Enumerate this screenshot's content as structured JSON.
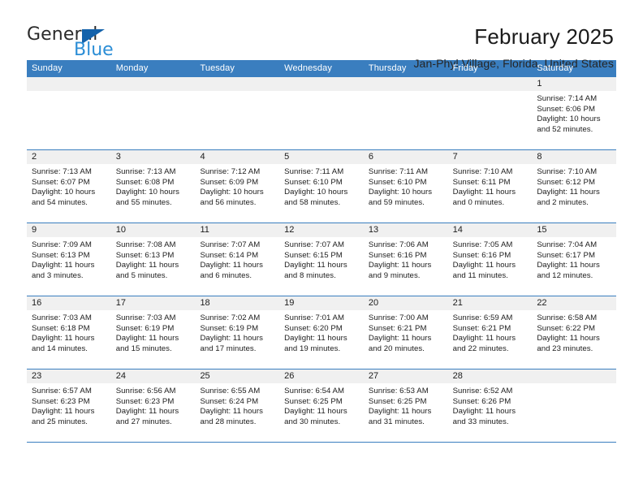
{
  "brand": {
    "name_part1": "General",
    "name_part2": "Blue",
    "triangle_color": "#1462ab",
    "blue_color": "#2c8ed6"
  },
  "header": {
    "title": "February 2025",
    "subtitle": "Jan-Phyl Village, Florida, United States",
    "accent_color": "#3a7ebf"
  },
  "weekdays": [
    "Sunday",
    "Monday",
    "Tuesday",
    "Wednesday",
    "Thursday",
    "Friday",
    "Saturday"
  ],
  "weeks": [
    [
      {
        "day": "",
        "empty": true
      },
      {
        "day": "",
        "empty": true
      },
      {
        "day": "",
        "empty": true
      },
      {
        "day": "",
        "empty": true
      },
      {
        "day": "",
        "empty": true
      },
      {
        "day": "",
        "empty": true
      },
      {
        "day": "1",
        "sunrise": "Sunrise: 7:14 AM",
        "sunset": "Sunset: 6:06 PM",
        "daylight_line1": "Daylight: 10 hours",
        "daylight_line2": "and 52 minutes."
      }
    ],
    [
      {
        "day": "2",
        "sunrise": "Sunrise: 7:13 AM",
        "sunset": "Sunset: 6:07 PM",
        "daylight_line1": "Daylight: 10 hours",
        "daylight_line2": "and 54 minutes."
      },
      {
        "day": "3",
        "sunrise": "Sunrise: 7:13 AM",
        "sunset": "Sunset: 6:08 PM",
        "daylight_line1": "Daylight: 10 hours",
        "daylight_line2": "and 55 minutes."
      },
      {
        "day": "4",
        "sunrise": "Sunrise: 7:12 AM",
        "sunset": "Sunset: 6:09 PM",
        "daylight_line1": "Daylight: 10 hours",
        "daylight_line2": "and 56 minutes."
      },
      {
        "day": "5",
        "sunrise": "Sunrise: 7:11 AM",
        "sunset": "Sunset: 6:10 PM",
        "daylight_line1": "Daylight: 10 hours",
        "daylight_line2": "and 58 minutes."
      },
      {
        "day": "6",
        "sunrise": "Sunrise: 7:11 AM",
        "sunset": "Sunset: 6:10 PM",
        "daylight_line1": "Daylight: 10 hours",
        "daylight_line2": "and 59 minutes."
      },
      {
        "day": "7",
        "sunrise": "Sunrise: 7:10 AM",
        "sunset": "Sunset: 6:11 PM",
        "daylight_line1": "Daylight: 11 hours",
        "daylight_line2": "and 0 minutes."
      },
      {
        "day": "8",
        "sunrise": "Sunrise: 7:10 AM",
        "sunset": "Sunset: 6:12 PM",
        "daylight_line1": "Daylight: 11 hours",
        "daylight_line2": "and 2 minutes."
      }
    ],
    [
      {
        "day": "9",
        "sunrise": "Sunrise: 7:09 AM",
        "sunset": "Sunset: 6:13 PM",
        "daylight_line1": "Daylight: 11 hours",
        "daylight_line2": "and 3 minutes."
      },
      {
        "day": "10",
        "sunrise": "Sunrise: 7:08 AM",
        "sunset": "Sunset: 6:13 PM",
        "daylight_line1": "Daylight: 11 hours",
        "daylight_line2": "and 5 minutes."
      },
      {
        "day": "11",
        "sunrise": "Sunrise: 7:07 AM",
        "sunset": "Sunset: 6:14 PM",
        "daylight_line1": "Daylight: 11 hours",
        "daylight_line2": "and 6 minutes."
      },
      {
        "day": "12",
        "sunrise": "Sunrise: 7:07 AM",
        "sunset": "Sunset: 6:15 PM",
        "daylight_line1": "Daylight: 11 hours",
        "daylight_line2": "and 8 minutes."
      },
      {
        "day": "13",
        "sunrise": "Sunrise: 7:06 AM",
        "sunset": "Sunset: 6:16 PM",
        "daylight_line1": "Daylight: 11 hours",
        "daylight_line2": "and 9 minutes."
      },
      {
        "day": "14",
        "sunrise": "Sunrise: 7:05 AM",
        "sunset": "Sunset: 6:16 PM",
        "daylight_line1": "Daylight: 11 hours",
        "daylight_line2": "and 11 minutes."
      },
      {
        "day": "15",
        "sunrise": "Sunrise: 7:04 AM",
        "sunset": "Sunset: 6:17 PM",
        "daylight_line1": "Daylight: 11 hours",
        "daylight_line2": "and 12 minutes."
      }
    ],
    [
      {
        "day": "16",
        "sunrise": "Sunrise: 7:03 AM",
        "sunset": "Sunset: 6:18 PM",
        "daylight_line1": "Daylight: 11 hours",
        "daylight_line2": "and 14 minutes."
      },
      {
        "day": "17",
        "sunrise": "Sunrise: 7:03 AM",
        "sunset": "Sunset: 6:19 PM",
        "daylight_line1": "Daylight: 11 hours",
        "daylight_line2": "and 15 minutes."
      },
      {
        "day": "18",
        "sunrise": "Sunrise: 7:02 AM",
        "sunset": "Sunset: 6:19 PM",
        "daylight_line1": "Daylight: 11 hours",
        "daylight_line2": "and 17 minutes."
      },
      {
        "day": "19",
        "sunrise": "Sunrise: 7:01 AM",
        "sunset": "Sunset: 6:20 PM",
        "daylight_line1": "Daylight: 11 hours",
        "daylight_line2": "and 19 minutes."
      },
      {
        "day": "20",
        "sunrise": "Sunrise: 7:00 AM",
        "sunset": "Sunset: 6:21 PM",
        "daylight_line1": "Daylight: 11 hours",
        "daylight_line2": "and 20 minutes."
      },
      {
        "day": "21",
        "sunrise": "Sunrise: 6:59 AM",
        "sunset": "Sunset: 6:21 PM",
        "daylight_line1": "Daylight: 11 hours",
        "daylight_line2": "and 22 minutes."
      },
      {
        "day": "22",
        "sunrise": "Sunrise: 6:58 AM",
        "sunset": "Sunset: 6:22 PM",
        "daylight_line1": "Daylight: 11 hours",
        "daylight_line2": "and 23 minutes."
      }
    ],
    [
      {
        "day": "23",
        "sunrise": "Sunrise: 6:57 AM",
        "sunset": "Sunset: 6:23 PM",
        "daylight_line1": "Daylight: 11 hours",
        "daylight_line2": "and 25 minutes."
      },
      {
        "day": "24",
        "sunrise": "Sunrise: 6:56 AM",
        "sunset": "Sunset: 6:23 PM",
        "daylight_line1": "Daylight: 11 hours",
        "daylight_line2": "and 27 minutes."
      },
      {
        "day": "25",
        "sunrise": "Sunrise: 6:55 AM",
        "sunset": "Sunset: 6:24 PM",
        "daylight_line1": "Daylight: 11 hours",
        "daylight_line2": "and 28 minutes."
      },
      {
        "day": "26",
        "sunrise": "Sunrise: 6:54 AM",
        "sunset": "Sunset: 6:25 PM",
        "daylight_line1": "Daylight: 11 hours",
        "daylight_line2": "and 30 minutes."
      },
      {
        "day": "27",
        "sunrise": "Sunrise: 6:53 AM",
        "sunset": "Sunset: 6:25 PM",
        "daylight_line1": "Daylight: 11 hours",
        "daylight_line2": "and 31 minutes."
      },
      {
        "day": "28",
        "sunrise": "Sunrise: 6:52 AM",
        "sunset": "Sunset: 6:26 PM",
        "daylight_line1": "Daylight: 11 hours",
        "daylight_line2": "and 33 minutes."
      },
      {
        "day": "",
        "empty": true
      }
    ]
  ]
}
